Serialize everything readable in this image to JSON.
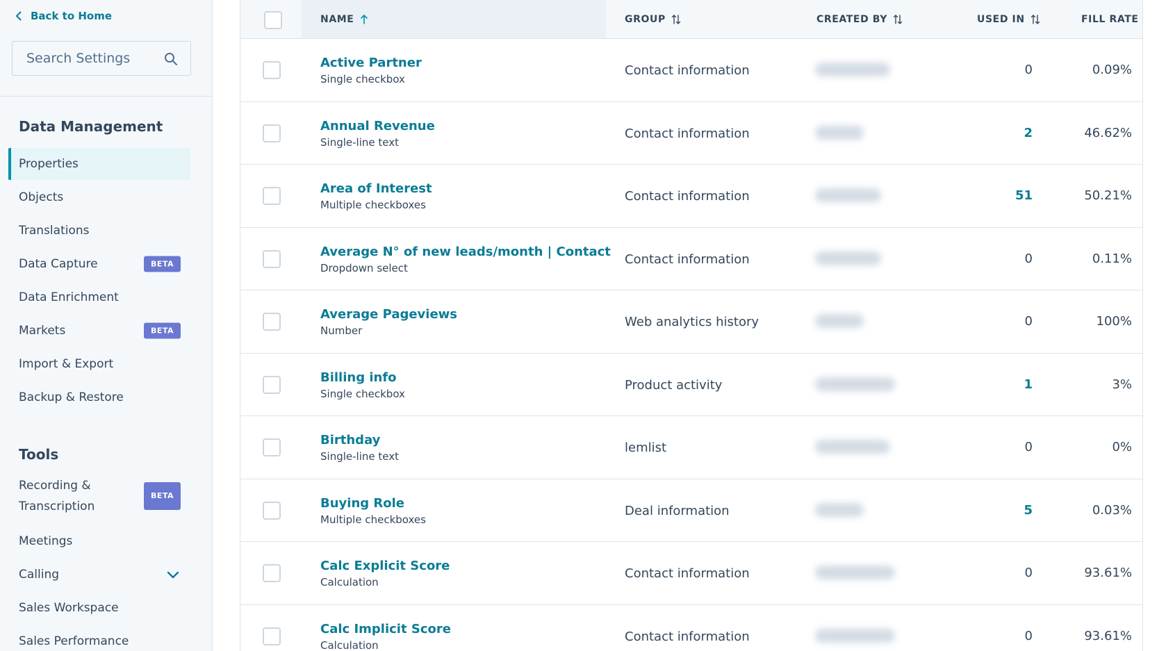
{
  "sidebar": {
    "back_label": "Back to Home",
    "search_placeholder": "Search Settings",
    "sections": [
      {
        "title": "Data Management",
        "items": [
          {
            "label": "Properties",
            "active": true
          },
          {
            "label": "Objects"
          },
          {
            "label": "Translations"
          },
          {
            "label": "Data Capture",
            "badge": "BETA"
          },
          {
            "label": "Data Enrichment"
          },
          {
            "label": "Markets",
            "badge": "BETA"
          },
          {
            "label": "Import & Export"
          },
          {
            "label": "Backup & Restore"
          }
        ]
      },
      {
        "title": "Tools",
        "items": [
          {
            "label": "Recording & Transcription",
            "badge": "BETA"
          },
          {
            "label": "Meetings"
          },
          {
            "label": "Calling",
            "expandable": true
          },
          {
            "label": "Sales Workspace"
          },
          {
            "label": "Sales Performance"
          }
        ]
      }
    ]
  },
  "table": {
    "headers": {
      "name": "NAME",
      "group": "GROUP",
      "created_by": "CREATED BY",
      "used_in": "USED IN",
      "fill_rate": "FILL RATE"
    },
    "sorted_column": "name",
    "rows": [
      {
        "name": "Active Partner",
        "type": "Single checkbox",
        "group": "Contact information",
        "used_in": "0",
        "fill_rate": "0.09%"
      },
      {
        "name": "Annual Revenue",
        "type": "Single-line text",
        "group": "Contact information",
        "used_in": "2",
        "fill_rate": "46.62%"
      },
      {
        "name": "Area of Interest",
        "type": "Multiple checkboxes",
        "group": "Contact information",
        "used_in": "51",
        "fill_rate": "50.21%"
      },
      {
        "name": "Average N° of new leads/month | Contact",
        "type": "Dropdown select",
        "group": "Contact information",
        "used_in": "0",
        "fill_rate": "0.11%"
      },
      {
        "name": "Average Pageviews",
        "type": "Number",
        "group": "Web analytics history",
        "used_in": "0",
        "fill_rate": "100%"
      },
      {
        "name": "Billing info",
        "type": "Single checkbox",
        "group": "Product activity",
        "used_in": "1",
        "fill_rate": "3%"
      },
      {
        "name": "Birthday",
        "type": "Single-line text",
        "group": "lemlist",
        "used_in": "0",
        "fill_rate": "0%"
      },
      {
        "name": "Buying Role",
        "type": "Multiple checkboxes",
        "group": "Deal information",
        "used_in": "5",
        "fill_rate": "0.03%"
      },
      {
        "name": "Calc Explicit Score",
        "type": "Calculation",
        "group": "Contact information",
        "used_in": "0",
        "fill_rate": "93.61%"
      },
      {
        "name": "Calc Implicit Score",
        "type": "Calculation",
        "group": "Contact information",
        "used_in": "0",
        "fill_rate": "93.61%"
      }
    ]
  },
  "colors": {
    "accent": "#0091ae",
    "link": "#0b7c95",
    "beta_badge": "#6a78d1",
    "sidebar_bg": "#f5f8fa",
    "active_item_bg": "#e5f5f8"
  },
  "icons": {
    "back": "chevron-left-icon",
    "search": "search-icon",
    "sort_asc": "arrow-up-icon",
    "sort_both": "sort-arrows-icon",
    "expand": "chevron-down-icon"
  }
}
